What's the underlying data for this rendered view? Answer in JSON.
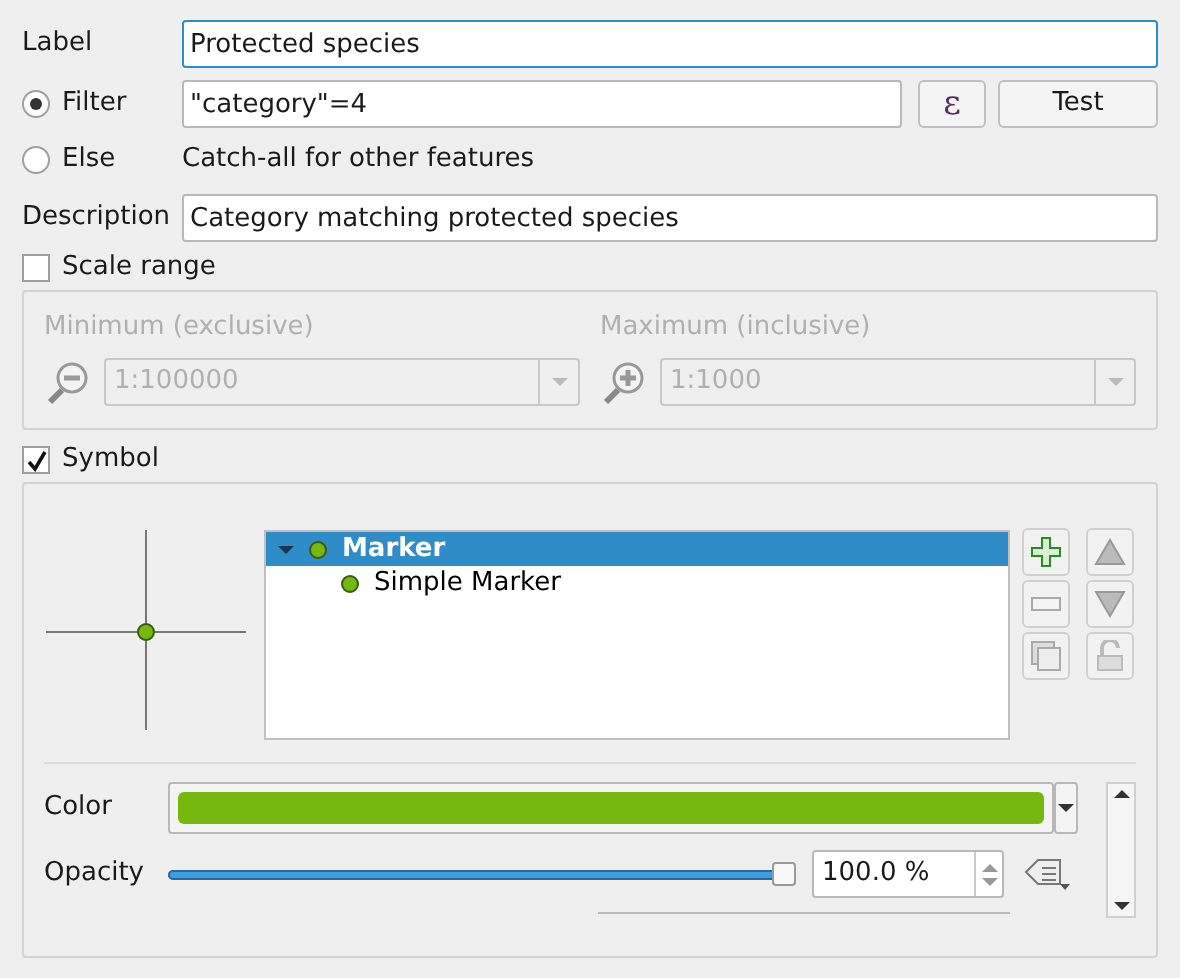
{
  "label": {
    "caption": "Label",
    "value": "Protected species"
  },
  "filter_mode": [
    {
      "label": "Filter",
      "selected": true
    },
    {
      "label": "Else",
      "selected": false
    }
  ],
  "filter": {
    "value": "\"category\"=4",
    "expression_button": "ε",
    "test_button": "Test"
  },
  "else_note": "Catch-all for other features",
  "description": {
    "caption": "Description",
    "value": "Category matching protected species"
  },
  "scale_range": {
    "label": "Scale range",
    "checked": false,
    "minimum": {
      "caption": "Minimum (exclusive)",
      "value": "1:100000"
    },
    "maximum": {
      "caption": "Maximum (inclusive)",
      "value": "1:1000"
    }
  },
  "symbol": {
    "label": "Symbol",
    "checked": true,
    "layers": [
      {
        "name": "Marker",
        "selected": true,
        "expanded": true,
        "children": [
          {
            "name": "Simple Marker",
            "selected": false
          }
        ]
      }
    ],
    "color_field": {
      "caption": "Color",
      "color": "#76b80e"
    },
    "opacity": {
      "caption": "Opacity",
      "level": 1,
      "value": "100.0 %"
    }
  }
}
